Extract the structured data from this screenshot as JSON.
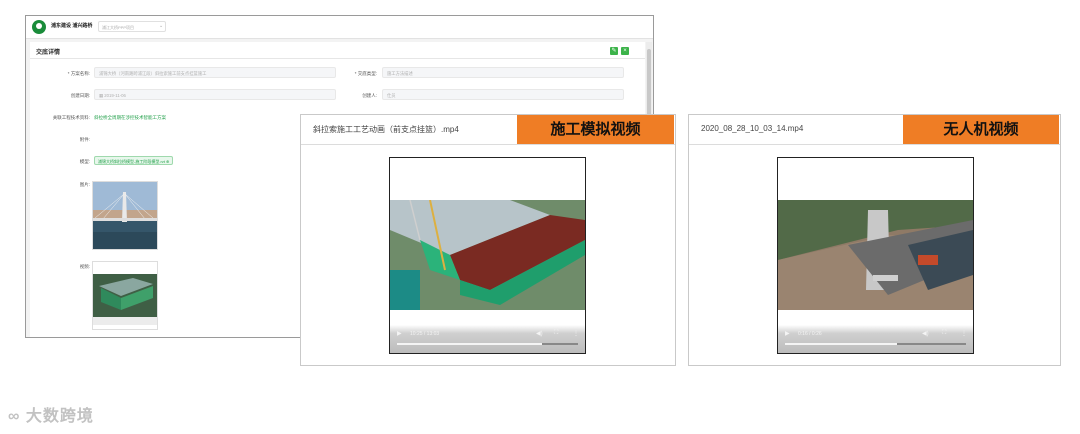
{
  "app": {
    "brand": "浦东建设 浦兴路桥",
    "project_select": "浦江大桥PPP项目",
    "panel_title": "交底详情",
    "form": {
      "scheme_name_label": "* 方案名称:",
      "scheme_name_value": "浦锦大桥（河南路跨浦江段）斜拉索施工前支点挂篮施工",
      "type_label": "* 交底类型:",
      "type_value": "施工方法描述",
      "date_label": "创建日期:",
      "date_value": "2019-11-06",
      "creator_label": "创建人:",
      "creator_value": "仕员",
      "tech_label": "关联工程技术资料:",
      "tech_value": "斜拉桥全周期在涉控技术智能工方案",
      "attach_label": "附件:",
      "model_label": "模型:",
      "model_tag": "浦锦大桥斜拉桥模型-施工阶段模型.rvt",
      "image_label": "图片:",
      "video_label": "视频:"
    }
  },
  "video1": {
    "filename": "斜拉索施工工艺动画（前支点挂篮）.mp4",
    "tag": "施工模拟视频",
    "time": "10:25 / 13:03",
    "progress": 0.8
  },
  "video2": {
    "filename": "2020_08_28_10_03_14.mp4",
    "tag": "无人机视频",
    "time": "0:16 / 0:26",
    "progress": 0.62
  },
  "watermark": "大数跨境"
}
